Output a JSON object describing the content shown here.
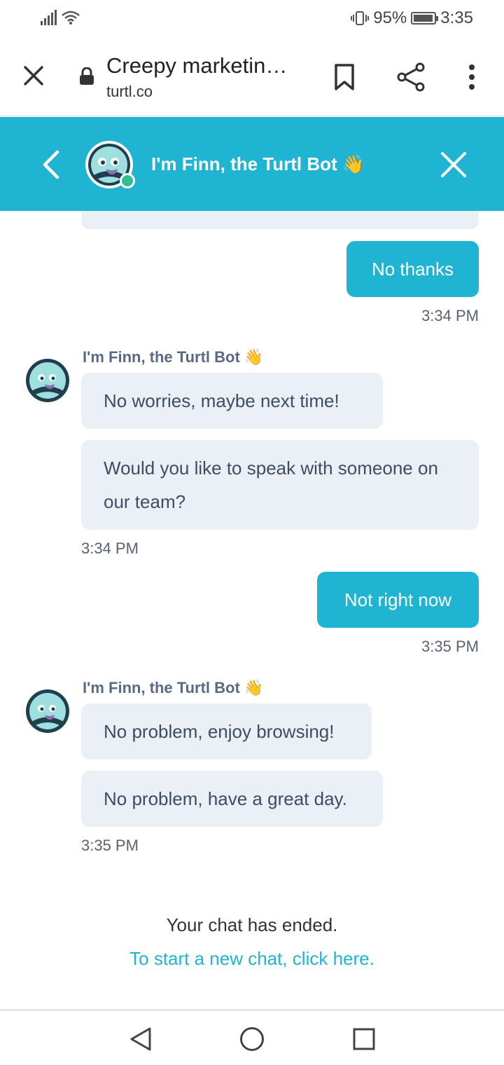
{
  "status_bar": {
    "battery_percent": "95%",
    "battery_level": 0.95,
    "time": "3:35"
  },
  "browser": {
    "title": "Creepy marketin…",
    "url": "turtl.co"
  },
  "chat": {
    "header_title": "I'm Finn, the Turtl Bot 👋",
    "bot_name": "I'm Finn, the Turtl Bot 👋",
    "messages": [
      {
        "from": "user",
        "text": "No thanks",
        "time": "3:34 PM"
      },
      {
        "from": "bot",
        "texts": [
          "No worries, maybe next time!",
          "Would you like to speak with someone on our team?"
        ],
        "time": "3:34 PM"
      },
      {
        "from": "user",
        "text": "Not right now",
        "time": "3:35 PM"
      },
      {
        "from": "bot",
        "texts": [
          "No problem, enjoy browsing!",
          "No problem, have a great day."
        ],
        "time": "3:35 PM"
      }
    ],
    "ended_text": "Your chat has ended.",
    "new_chat_link": "To start a new chat, click here."
  },
  "colors": {
    "accent": "#1fb5d2",
    "bot_bubble": "#ebeff6",
    "online": "#2fbf8f"
  }
}
